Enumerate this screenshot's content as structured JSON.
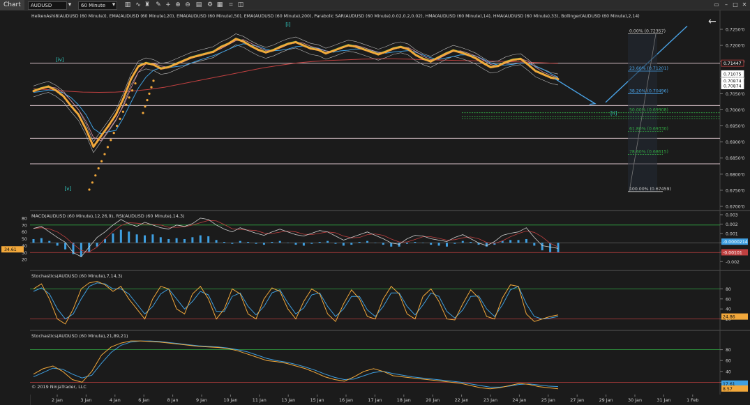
{
  "toolbar": {
    "chart_tab": "Chart",
    "instrument": "AUDUSD",
    "timeframe": "60 Minute"
  },
  "panels": {
    "price_title": "HeikenAshi8(AUDUSD (60 Minute)), EMA(AUDUSD (60 Minute),20), EMA(AUDUSD (60 Minute),50), EMA(AUDUSD (60 Minute),200), Parabolic SAR(AUDUSD (60 Minute),0.02,0.2,0.02), HMA(AUDUSD (60 Minute),14), HMA(AUDUSD (60 Minute),33), Bollinger(AUDUSD (60 Minute),2,14)",
    "macd_title": "MACD(AUDUSD (60 Minute),12,26,9), RSI(AUDUSD (60 Minute),14,3)",
    "stoch1_title": "Stochastics(AUDUSD (60 Minute),7,14,3)",
    "stoch2_title": "Stochastics(AUDUSD (60 Minute),21,89,21)",
    "copyright": "© 2019 NinjaTrader, LLC"
  },
  "colors": {
    "background": "#1b1b1b",
    "ema_orange": "#f2a83b",
    "blue_line": "#3f9fe0",
    "green_line": "#33aa44",
    "red_line": "#c04040",
    "fib_blue": "#4aa3e6",
    "fib_green": "#33aa44",
    "fib_white": "#cccccc",
    "wave_label": "#33d6cc"
  },
  "chart_data": {
    "type": "line",
    "x_dates": [
      "2 Jan",
      "3 Jan",
      "4 Jan",
      "6 Jan",
      "8 Jan",
      "9 Jan",
      "10 Jan",
      "11 Jan",
      "13 Jan",
      "15 Jan",
      "16 Jan",
      "17 Jan",
      "18 Jan",
      "20 Jan",
      "22 Jan",
      "23 Jan",
      "24 Jan",
      "25 Jan",
      "27 Jan",
      "29 Jan",
      "30 Jan",
      "31 Jan",
      "1 Feb"
    ],
    "price_axis": {
      "ticks": [
        "0.7250'0",
        "0.7200'0",
        "0.7150'0",
        "0.7100'0",
        "0.7050'0",
        "0.7000'0",
        "0.6950'0",
        "0.6900'0",
        "0.6850'0",
        "0.6800'0",
        "0.6750'0",
        "0.6700'0"
      ],
      "ylim": [
        0.67,
        0.725
      ],
      "price_boxes": [
        {
          "label": "0.71447",
          "value": 0.71447,
          "style": "red-outline"
        },
        {
          "label": "0.71075",
          "value": 0.71075,
          "style": "white"
        },
        {
          "label": "0.70874",
          "value": 0.70874,
          "style": "white"
        },
        {
          "label": "0.70874",
          "value": 0.70874,
          "style": "white"
        }
      ]
    },
    "horizontal_levels": [
      0.71447,
      0.70131,
      0.69115,
      0.6832
    ],
    "fibonacci": [
      {
        "label": "0.00% (0.72357)",
        "value": 0.72357,
        "color": "white"
      },
      {
        "label": "23.60% (0.71201)",
        "value": 0.71201,
        "color": "blue"
      },
      {
        "label": "38.20% (0.70496)",
        "value": 0.70496,
        "color": "blue"
      },
      {
        "label": "50.00% (0.69908)",
        "value": 0.69908,
        "color": "green"
      },
      {
        "label": "61.80% (0.69330)",
        "value": 0.6933,
        "color": "green"
      },
      {
        "label": "78.60% (0.68615)",
        "value": 0.68615,
        "color": "green"
      },
      {
        "label": "100.00% (0.67459)",
        "value": 0.67459,
        "color": "white"
      }
    ],
    "wave_labels": [
      {
        "label": "[iv]",
        "date_index": 0.05,
        "price": 0.715
      },
      {
        "label": "[v]",
        "date_index": 0.35,
        "price": 0.675
      },
      {
        "label": "[i]",
        "date_index": 8.0,
        "price": 0.726
      },
      {
        "label": "[ii]",
        "date_index": 19.25,
        "price": 0.6985
      }
    ],
    "price_series": [
      0.7058,
      0.7066,
      0.7072,
      0.706,
      0.7042,
      0.7012,
      0.6985,
      0.694,
      0.6885,
      0.6918,
      0.695,
      0.6985,
      0.7035,
      0.7095,
      0.7135,
      0.7145,
      0.714,
      0.7128,
      0.7132,
      0.7142,
      0.7152,
      0.7162,
      0.7168,
      0.7174,
      0.718,
      0.7195,
      0.7205,
      0.722,
      0.7212,
      0.7198,
      0.7186,
      0.7178,
      0.7185,
      0.7196,
      0.7205,
      0.721,
      0.72,
      0.719,
      0.7186,
      0.7175,
      0.7183,
      0.7192,
      0.72,
      0.7196,
      0.7188,
      0.718,
      0.7172,
      0.718,
      0.719,
      0.7195,
      0.7188,
      0.717,
      0.7158,
      0.715,
      0.7162,
      0.7174,
      0.7184,
      0.7178,
      0.717,
      0.716,
      0.7145,
      0.7132,
      0.7136,
      0.7148,
      0.7155,
      0.7158,
      0.714,
      0.712,
      0.711,
      0.71,
      0.7095
    ],
    "ema200_series": [
      0.7065,
      0.7062,
      0.7058,
      0.7055,
      0.7054,
      0.7055,
      0.7058,
      0.7063,
      0.707,
      0.708,
      0.709,
      0.71,
      0.711,
      0.712,
      0.713,
      0.7138,
      0.7145,
      0.715,
      0.7153,
      0.7155,
      0.7157,
      0.7158,
      0.7158,
      0.7157,
      0.7155,
      0.7154,
      0.7153,
      0.7152,
      0.7151,
      0.715,
      0.7148,
      0.7146,
      0.7144
    ],
    "macd_panel": {
      "y_ticks_left": [
        "80",
        "70",
        "60",
        "50",
        "40",
        "30",
        "20"
      ],
      "y_ticks_right": [
        "0.003",
        "0.002",
        "0.001",
        "0",
        "-0.001",
        "-0.002"
      ],
      "rsi_levels": [
        70,
        30
      ],
      "boxes": [
        {
          "label": "-0.0000214",
          "value": -2.14e-05,
          "color": "blue"
        },
        {
          "label": "-0.00101",
          "value": -0.00101,
          "color": "red"
        },
        {
          "label": "34.61",
          "value": 34.61,
          "color": "orange"
        }
      ],
      "rsi_series": [
        65,
        68,
        60,
        52,
        45,
        30,
        24,
        38,
        52,
        60,
        70,
        78,
        72,
        68,
        74,
        70,
        66,
        64,
        70,
        68,
        72,
        80,
        78,
        70,
        64,
        60,
        66,
        62,
        58,
        55,
        60,
        64,
        60,
        56,
        54,
        58,
        62,
        60,
        54,
        48,
        52,
        56,
        60,
        55,
        50,
        44,
        42,
        50,
        55,
        54,
        50,
        48,
        46,
        52,
        56,
        50,
        44,
        40,
        46,
        55,
        58,
        60,
        66,
        52,
        40,
        38,
        36
      ],
      "histogram": [
        0.0004,
        0.0005,
        0.0002,
        -0.0003,
        -0.0007,
        -0.0012,
        -0.0015,
        -0.001,
        -0.0004,
        0.0004,
        0.001,
        0.0014,
        0.0012,
        0.0009,
        0.0008,
        0.0009,
        0.0006,
        0.0004,
        0.0005,
        0.0004,
        0.0006,
        0.0008,
        0.0007,
        0.0003,
        0.0001,
        -0.0001,
        0.0002,
        0.0001,
        -0.0001,
        -0.0002,
        0.0001,
        0.0002,
        0.0,
        -0.0002,
        -0.0003,
        -0.0001,
        0.0001,
        0.0002,
        -0.0001,
        -0.0003,
        -0.0002,
        0.0001,
        0.0002,
        0.0,
        -0.0002,
        -0.0004,
        -0.0004,
        -0.0001,
        0.0001,
        0.0,
        -0.0002,
        -0.0003,
        -0.0004,
        -0.0001,
        0.0002,
        0.0001,
        -0.0002,
        -0.0004,
        -0.0002,
        0.0002,
        0.0003,
        0.0003,
        0.0004,
        -0.0003,
        -0.0008,
        -0.001,
        -0.001
      ]
    },
    "stoch1_panel": {
      "y_ticks": [
        "80",
        "60",
        "40",
        "20"
      ],
      "levels": [
        80,
        20
      ],
      "boxes": [
        {
          "label": "24.86",
          "value": 24.86,
          "color": "orange"
        }
      ],
      "k_series": [
        80,
        90,
        60,
        20,
        10,
        40,
        80,
        92,
        95,
        88,
        75,
        85,
        60,
        40,
        20,
        60,
        85,
        80,
        40,
        30,
        70,
        85,
        60,
        20,
        40,
        80,
        70,
        30,
        20,
        60,
        82,
        75,
        40,
        20,
        55,
        80,
        70,
        30,
        15,
        50,
        78,
        60,
        25,
        20,
        60,
        85,
        70,
        30,
        20,
        65,
        80,
        55,
        20,
        18,
        50,
        78,
        62,
        25,
        20,
        62,
        88,
        85,
        30,
        15,
        20,
        25,
        28
      ],
      "d_series": [
        75,
        82,
        70,
        40,
        20,
        30,
        60,
        85,
        92,
        90,
        80,
        80,
        70,
        50,
        30,
        45,
        70,
        80,
        60,
        40,
        55,
        75,
        68,
        35,
        35,
        65,
        72,
        45,
        28,
        45,
        72,
        78,
        52,
        30,
        42,
        68,
        72,
        45,
        25,
        40,
        65,
        65,
        38,
        25,
        45,
        72,
        72,
        45,
        28,
        48,
        72,
        65,
        35,
        22,
        38,
        65,
        66,
        40,
        25,
        48,
        78,
        85,
        50,
        25,
        20,
        22,
        25
      ]
    },
    "stoch2_panel": {
      "y_ticks": [
        "80",
        "60",
        "40",
        "20"
      ],
      "levels": [
        80,
        20
      ],
      "boxes": [
        {
          "label": "17.61",
          "value": 17.61,
          "color": "blue"
        },
        {
          "label": "8.57",
          "value": 8.57,
          "color": "orange"
        }
      ],
      "k_series": [
        35,
        45,
        50,
        40,
        25,
        20,
        40,
        70,
        85,
        92,
        96,
        96,
        95,
        94,
        92,
        90,
        88,
        86,
        85,
        84,
        82,
        78,
        72,
        66,
        60,
        58,
        55,
        50,
        45,
        38,
        30,
        25,
        22,
        30,
        40,
        45,
        40,
        32,
        30,
        28,
        26,
        24,
        22,
        20,
        18,
        14,
        10,
        8,
        10,
        14,
        18,
        16,
        12,
        10,
        8
      ],
      "d_series": [
        30,
        38,
        46,
        44,
        35,
        28,
        33,
        55,
        75,
        88,
        94,
        96,
        96,
        95,
        93,
        91,
        89,
        87,
        86,
        85,
        83,
        80,
        76,
        70,
        64,
        60,
        57,
        53,
        48,
        42,
        35,
        29,
        25,
        26,
        32,
        38,
        40,
        36,
        33,
        30,
        28,
        26,
        24,
        22,
        20,
        17,
        14,
        11,
        11,
        13,
        16,
        17,
        15,
        13,
        12
      ]
    }
  }
}
